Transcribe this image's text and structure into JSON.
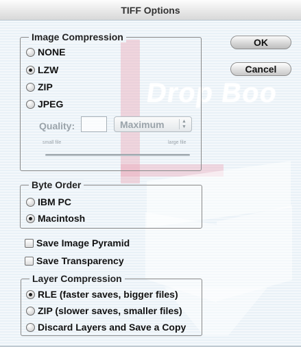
{
  "window": {
    "title": "TIFF Options"
  },
  "buttons": {
    "ok": "OK",
    "cancel": "Cancel"
  },
  "image_compression": {
    "title": "Image Compression",
    "options": [
      "NONE",
      "LZW",
      "ZIP",
      "JPEG"
    ],
    "selected": "LZW",
    "quality_label": "Quality:",
    "quality_value": "",
    "quality_select_value": "Maximum",
    "small_file_label": "small file",
    "large_file_label": "large file"
  },
  "byte_order": {
    "title": "Byte Order",
    "options": [
      "IBM PC",
      "Macintosh"
    ],
    "selected": "Macintosh"
  },
  "checkboxes": {
    "save_image_pyramid": "Save Image Pyramid",
    "save_transparency": "Save Transparency"
  },
  "layer_compression": {
    "title": "Layer Compression",
    "options": [
      "RLE (faster saves, bigger files)",
      "ZIP (slower saves, smaller files)",
      "Discard Layers and Save a Copy"
    ],
    "selected": "RLE (faster saves, bigger files)"
  },
  "watermark": {
    "text": "Drop Boo",
    "colors": {
      "pink": "#ebaab9",
      "white": "#ffffff"
    }
  },
  "icons": {
    "radio": "radio-button",
    "checkbox": "checkbox",
    "select_arrows": "up-down-arrows-icon"
  }
}
